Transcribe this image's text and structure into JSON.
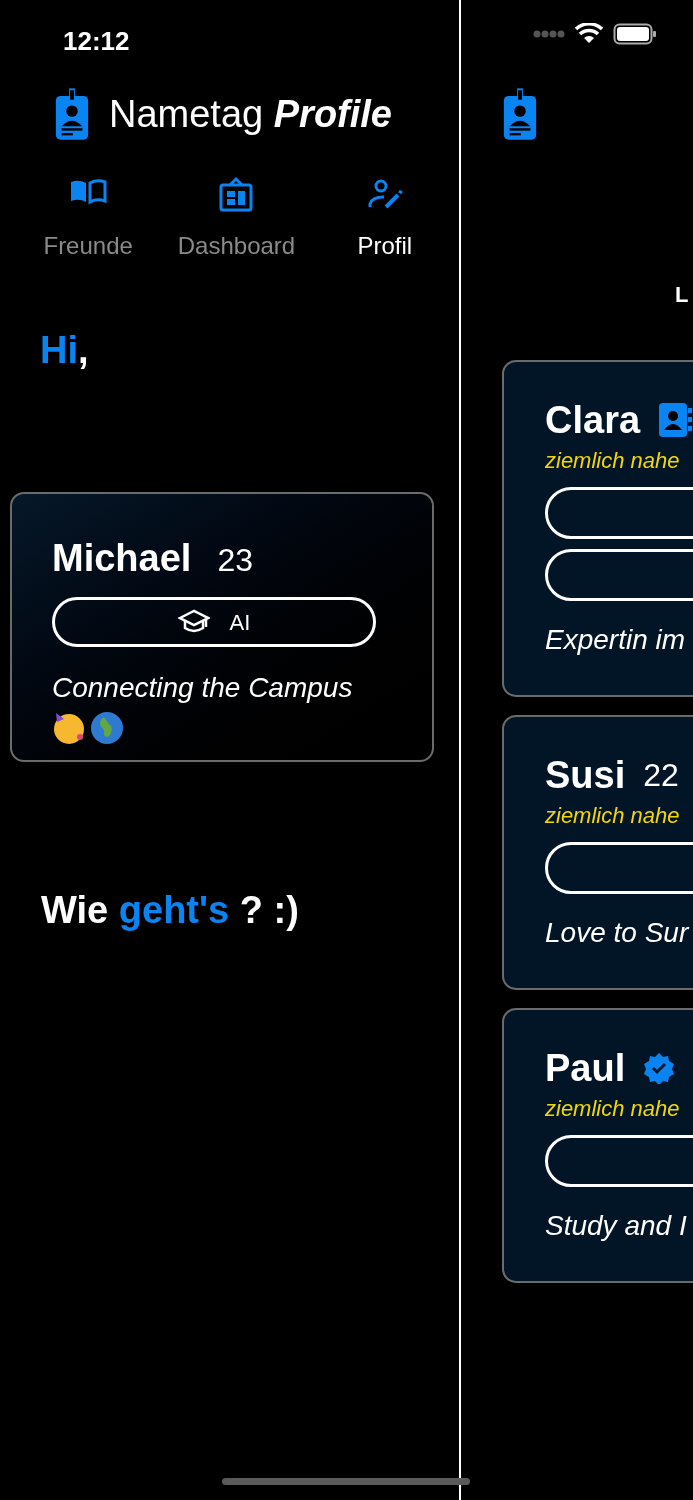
{
  "status_bar": {
    "time": "12:12"
  },
  "header": {
    "title_plain": "Nametag",
    "title_emphasis": "Profile"
  },
  "tabs": [
    {
      "label": "Freunde",
      "selected": false
    },
    {
      "label": "Dashboard",
      "selected": false
    },
    {
      "label": "Profil",
      "selected": true
    }
  ],
  "greeting": [
    {
      "text": "Hi",
      "accent": true
    },
    {
      "text": ",",
      "accent": false
    }
  ],
  "profile_card": {
    "name": "Michael",
    "age": "23",
    "field": "AI",
    "bio": "Connecting the Campus"
  },
  "question": [
    {
      "text": "Wie ",
      "accent": false
    },
    {
      "text": "geht's",
      "accent": true
    },
    {
      "text": " ? :)",
      "accent": false
    }
  ],
  "right_pane": {
    "heading": "L",
    "cards": [
      {
        "name": "Clara",
        "kind": "contact",
        "distance": "ziemlich nahe",
        "bio": "Expertin im"
      },
      {
        "name": "Susi",
        "age": "22",
        "kind": "plain",
        "distance": "ziemlich nahe",
        "bio": "Love to Sur"
      },
      {
        "name": "Paul",
        "kind": "verified",
        "distance": "ziemlich nahe",
        "bio": "Study and I"
      }
    ]
  }
}
